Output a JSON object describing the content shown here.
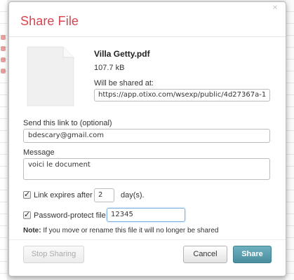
{
  "dialog": {
    "title": "Share File",
    "file": {
      "name": "Villa Getty.pdf",
      "size": "107.7 kB"
    },
    "shared_at_label": "Will be shared at:",
    "shared_url": "https://app.otixo.com/wsexp/public/4d27367a-1",
    "send_link_label": "Send this link to (optional)",
    "email_value": "bdescary@gmail.com",
    "message_label": "Message",
    "message_value": "voici le document",
    "expires": {
      "checked": true,
      "label": "Link expires after",
      "days_value": "2",
      "unit": "day(s)."
    },
    "password": {
      "checked": true,
      "label": "Password-protect file",
      "value": "12345"
    },
    "note_prefix": "Note:",
    "note_text": " If you move or rename this file it will no longer be shared",
    "buttons": {
      "stop_sharing": "Stop Sharing",
      "cancel": "Cancel",
      "share": "Share"
    },
    "colors": {
      "title": "#d9434f",
      "share_button": "#4a8e9f"
    }
  }
}
